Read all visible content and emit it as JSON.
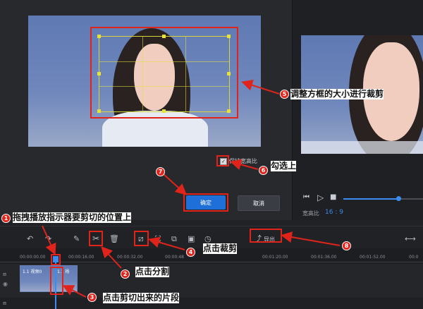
{
  "dialog": {
    "checkbox_label": "保持宽高比",
    "confirm_button": "确定",
    "cancel_button": "取消"
  },
  "preview": {
    "aspect_label": "宽高比",
    "aspect_value": "16 : 9"
  },
  "toolbar": {
    "export_label": "导出"
  },
  "timeline": {
    "ticks": [
      "00:00:00.00",
      "00:00:16.00",
      "00:00:32.00",
      "00:00:48",
      "00:01:20.00",
      "00:01:36.00",
      "00:01:52.00",
      "00:0"
    ],
    "clip1_label": "1.1 视频0",
    "clip2_label": "1.1 杨"
  },
  "annotations": {
    "n1": "1",
    "t1": "拖拽播放指示器要剪切的位置上",
    "n2": "2",
    "t2": "点击分割",
    "n3": "3",
    "t3": "点击剪切出来的片段",
    "n4": "4",
    "t4": "点击裁剪",
    "n5": "5",
    "t5": "调整方框的大小进行裁剪",
    "n6": "6",
    "t6": "勾选上",
    "n7": "7",
    "n8": "8"
  },
  "colors": {
    "annotation_red": "#e0241b",
    "accent_blue": "#1e6fd8",
    "crop_frame": "#e6e23a"
  }
}
